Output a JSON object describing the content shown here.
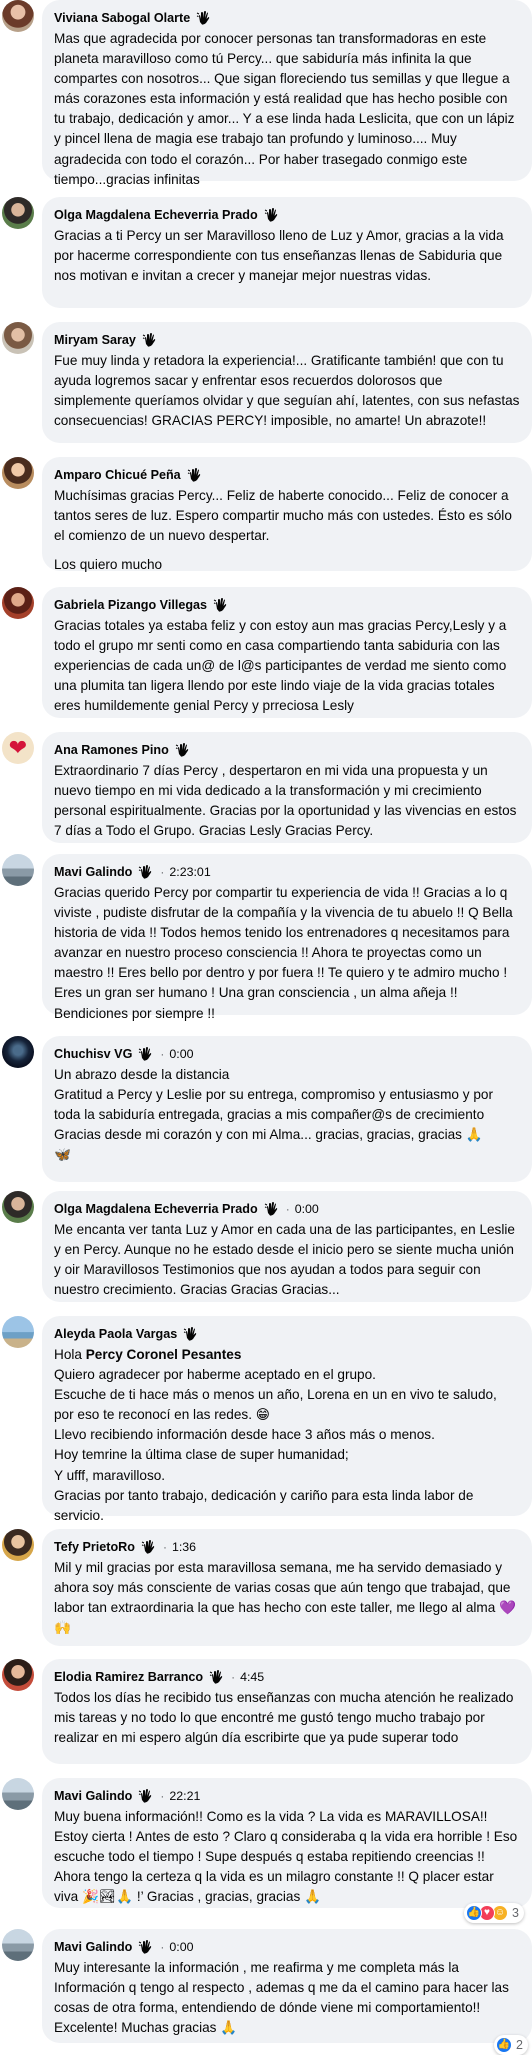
{
  "colors": {
    "bubble_bg": "#f0f2f5",
    "like_blue": "#1877f2",
    "love_red": "#f33e58",
    "care_yellow": "#f7b125"
  },
  "comments": [
    {
      "author": "Viviana Sabogal Olarte",
      "time": "",
      "text": "Mas que agradecida por conocer personas tan transformadoras en este planeta maravilloso como tú Percy... que sabiduría más infinita la que compartes con nosotros... Que sigan floreciendo tus semillas y que llegue a más corazones esta información y está realidad que has hecho posible con tu trabajo, dedicación y amor... Y a ese linda hada Leslicita, que con un lápiz y pincel llena de magia ese trabajo tan profundo y luminoso.... Muy agradecida con todo el corazón... Por haber trasegado conmigo este tiempo...gracias infinitas",
      "avatar_icon": "profile-photo-icon"
    },
    {
      "author": "Olga Magdalena Echeverria Prado",
      "time": "",
      "text": "Gracias a ti Percy un ser Maravilloso lleno de Luz y Amor, gracias a la vida por hacerme correspondiente con tus enseñanzas llenas de Sabiduria que nos motivan e invitan a crecer y manejar mejor nuestras vidas.",
      "avatar_icon": "profile-photo-icon"
    },
    {
      "author": "Miryam Saray",
      "time": "",
      "text": "Fue muy linda y retadora la experiencia!... Gratificante también! que con tu ayuda logremos sacar y enfrentar esos recuerdos dolorosos que simplemente queríamos olvidar y que seguían ahí, latentes, con sus nefastas consecuencias! GRACIAS PERCY! imposible, no amarte! Un abrazote!!",
      "avatar_icon": "profile-photo-icon"
    },
    {
      "author": "Amparo Chicué Peña",
      "time": "",
      "text": "Muchísimas gracias Percy... Feliz de haberte conocido... Feliz de conocer a tantos seres de luz. Espero compartir mucho más con ustedes. Ésto es sólo el comienzo de un nuevo despertar.",
      "text2": "Los quiero mucho",
      "avatar_icon": "profile-photo-icon"
    },
    {
      "author": "Gabriela Pizango Villegas",
      "time": "",
      "text": "Gracias totales ya estaba feliz y con estoy aun mas gracias Percy,Lesly y a todo el grupo mr senti como en casa compartiendo tanta sabiduria con las experiencias de cada un@ de l@s participantes de verdad me siento como una plumita tan ligera llendo por este lindo viaje de la vida gracias totales eres humildemente genial Percy y prreciosa Lesly",
      "avatar_icon": "profile-photo-icon"
    },
    {
      "author": "Ana Ramones Pino",
      "time": "",
      "text": "Extraordinario 7 días Percy , despertaron en mi vida una propuesta y un nuevo tiempo en mi vida dedicado a la transformación y mi crecimiento personal espiritualmente. Gracias por la oportunidad y las vivencias en estos 7 días a Todo el Grupo. Gracias Lesly Gracias Percy.",
      "avatar_icon": "heart-avatar-icon"
    },
    {
      "author": "Mavi Galindo",
      "time": "2:23:01",
      "text": "Gracias querido Percy por compartir tu experiencia de vida !! Gracias a lo q viviste , pudiste disfrutar de la compañía y la vivencia de tu abuelo !! Q Bella historia de vida !! Todos hemos tenido los entrenadores q necesitamos para avanzar en nuestro proceso consciencia !! Ahora te proyectas como un maestro !! Eres bello por dentro y por fuera !! Te quiero y te admiro mucho ! Eres un gran ser humano ! Una gran consciencia , un alma añeja !! Bendiciones por siempre !!",
      "avatar_icon": "profile-photo-icon"
    },
    {
      "author": "Chuchisv VG",
      "time": "0:00",
      "text": "Un abrazo desde la distancia\nGratitud a Percy y Leslie por su entrega, compromiso y entusiasmo y por toda la sabiduría entregada, gracias a mis compañer@s de crecimiento\nGracias desde mi corazón y con mi Alma... gracias, gracias, gracias 🙏\n🦋",
      "avatar_icon": "profile-photo-icon"
    },
    {
      "author": "Olga Magdalena Echeverria Prado",
      "time": "0:00",
      "text": "Me encanta ver tanta Luz y Amor en cada una de las participantes, en Leslie y en Percy. Aunque no he estado desde el inicio pero se siente mucha unión y oir Maravillosos Testimonios que nos ayudan a todos para seguir con nuestro crecimiento. Gracias Gracias Gracias...",
      "avatar_icon": "profile-photo-icon"
    },
    {
      "author": "Aleyda Paola Vargas",
      "time": "",
      "mention_prefix": "Hola ",
      "mention": "Percy Coronel Pesantes",
      "text": "Quiero agradecer por haberme aceptado en el grupo.\nEscuche de ti hace más o menos un año, Lorena en un en vivo te saludo, por eso te reconocí en las redes. 😁\nLlevo recibiendo información desde hace 3 años más o menos.\nHoy temrine la última clase de super humanidad;\nY ufff, maravilloso.\nGracias por tanto trabajo, dedicación y cariño para esta linda labor de servicio.",
      "avatar_icon": "profile-photo-icon"
    },
    {
      "author": "Tefy PrietoRo",
      "time": "1:36",
      "text": "Mil y mil gracias por esta maravillosa semana, me ha servido demasiado y ahora soy más consciente de varias cosas que aún tengo que trabajad, que labor tan extraordinaria la que has hecho con este taller, me llego al alma 💜🙌",
      "avatar_icon": "profile-photo-icon"
    },
    {
      "author": "Elodia Ramirez Barranco",
      "time": "4:45",
      "text": "Todos los días he recibido tus enseñanzas con mucha atención he realizado mis tareas y no todo lo que encontré me gustó tengo mucho trabajo por realizar en mi espero algún día escribirte que ya pude superar todo",
      "avatar_icon": "profile-photo-icon"
    },
    {
      "author": "Mavi Galindo",
      "time": "22:21",
      "text": "Muy buena información!! Como es la vida ? La vida es MARAVILLOSA!! Estoy cierta ! Antes de esto ? Claro q consideraba q la vida era horrible ! Eso escuche todo el tiempo ! Supe después q estaba repitiendo creencias !! Ahora tengo la certeza q la vida es un milagro constante !! Q placer estar viva 🎉🏞🙏 !’ Gracias , gracias, gracias 🙏",
      "reactions_count": "3",
      "avatar_icon": "profile-photo-icon"
    },
    {
      "author": "Mavi Galindo",
      "time": "0:00",
      "text": "Muy interesante la información , me reafirma y me completa más la Información q tengo al respecto , ademas q me da el camino para hacer las cosas de otra forma, entendiendo de dónde viene mi comportamiento!! Excelente! Muchas gracias 🙏",
      "reactions_count": "2",
      "avatar_icon": "profile-photo-icon"
    }
  ]
}
